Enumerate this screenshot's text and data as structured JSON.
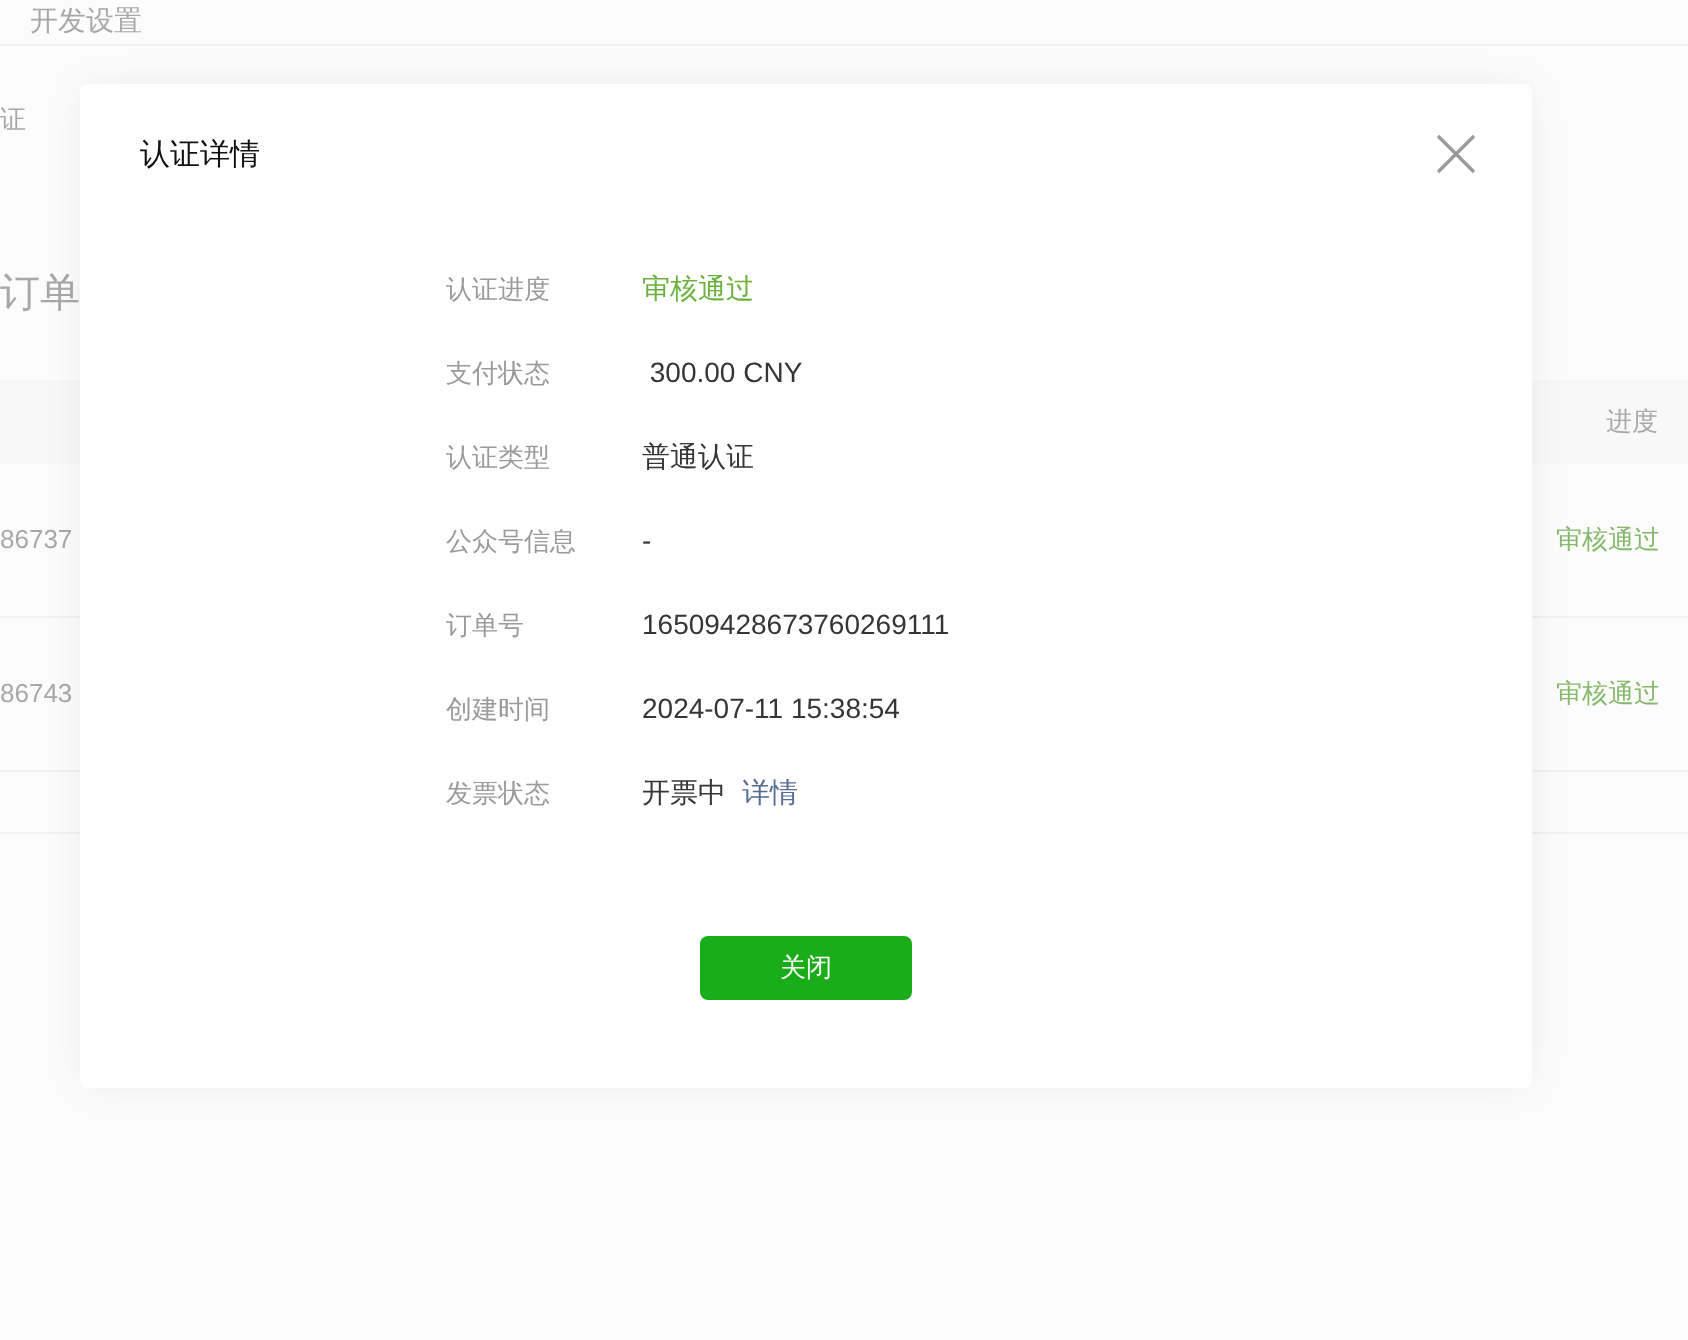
{
  "background": {
    "top_nav": "开发设置",
    "section_label": "证",
    "section_title": "订单",
    "table": {
      "columns": [
        "进度"
      ],
      "rows": [
        {
          "order": "86737",
          "progress": "审核通过"
        },
        {
          "order": "86743",
          "progress": "审核通过"
        }
      ]
    }
  },
  "dialog": {
    "title": "认证详情",
    "fields": [
      {
        "label": "认证进度",
        "kind": "status",
        "value": "审核通过"
      },
      {
        "label": "支付状态",
        "kind": "text",
        "value": " 300.00 CNY"
      },
      {
        "label": "认证类型",
        "kind": "text",
        "value": "普通认证"
      },
      {
        "label": "公众号信息",
        "kind": "text",
        "value": "-"
      },
      {
        "label": "订单号",
        "kind": "text",
        "value": "16509428673760269111"
      },
      {
        "label": "创建时间",
        "kind": "text",
        "value": "2024-07-11 15:38:54"
      },
      {
        "label": "发票状态",
        "kind": "link",
        "value": "开票中",
        "link": "详情"
      }
    ],
    "close_button": "关闭"
  }
}
